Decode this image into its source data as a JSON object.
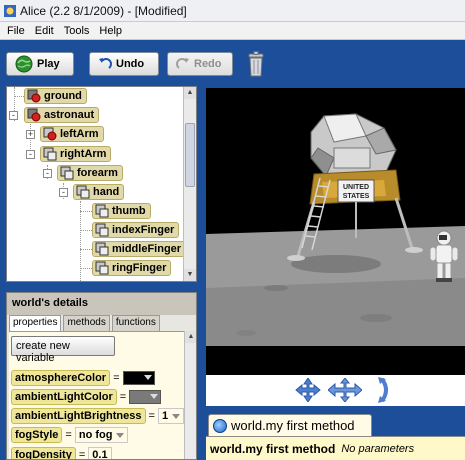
{
  "window": {
    "title": "Alice (2.2  8/1/2009) - [Modified]"
  },
  "menu": {
    "items": [
      "File",
      "Edit",
      "Tools",
      "Help"
    ]
  },
  "toolbar": {
    "play_label": "Play",
    "undo_label": "Undo",
    "redo_label": "Redo",
    "icons": {
      "play": "play-globe-icon",
      "undo": "undo-arrow-icon",
      "redo": "redo-arrow-icon",
      "trash": "trash-can-icon"
    }
  },
  "object_tree": {
    "items": [
      {
        "label": "ground",
        "level": 1,
        "expander": ""
      },
      {
        "label": "astronaut",
        "level": 0,
        "expander": "-"
      },
      {
        "label": "leftArm",
        "level": 1,
        "expander": "+"
      },
      {
        "label": "rightArm",
        "level": 1,
        "expander": "-"
      },
      {
        "label": "forearm",
        "level": 2,
        "expander": "-"
      },
      {
        "label": "hand",
        "level": 3,
        "expander": "-"
      },
      {
        "label": "thumb",
        "level": 4,
        "expander": ""
      },
      {
        "label": "indexFinger",
        "level": 4,
        "expander": ""
      },
      {
        "label": "middleFinger",
        "level": 4,
        "expander": ""
      },
      {
        "label": "ringFinger",
        "level": 4,
        "expander": ""
      }
    ]
  },
  "details": {
    "title": "world's details",
    "tabs": [
      "properties",
      "methods",
      "functions"
    ],
    "active_tab": "properties",
    "create_variable_label": "create new variable",
    "properties": [
      {
        "name": "atmosphereColor",
        "value_kind": "color",
        "color": "#000000"
      },
      {
        "name": "ambientLightColor",
        "value_kind": "color",
        "color": "#7a7a7a"
      },
      {
        "name": "ambientLightBrightness",
        "value": "1"
      },
      {
        "name": "fogStyle",
        "value": "no fog"
      },
      {
        "name": "fogDensity",
        "value": "0.1"
      }
    ],
    "equals": "="
  },
  "scene": {
    "flag_line1": "UNITED",
    "flag_line2": "STATES",
    "colors": {
      "sky": "#000000",
      "ground": "#9c9c9c"
    }
  },
  "camera_controls": {
    "icons": [
      "move-camera-arrows-icon",
      "pan-camera-arrows-icon",
      "tilt-camera-arrows-icon"
    ]
  },
  "method_editor": {
    "tab_label": "world.my first method",
    "signature": "world.my first method",
    "params_note": "No parameters"
  }
}
